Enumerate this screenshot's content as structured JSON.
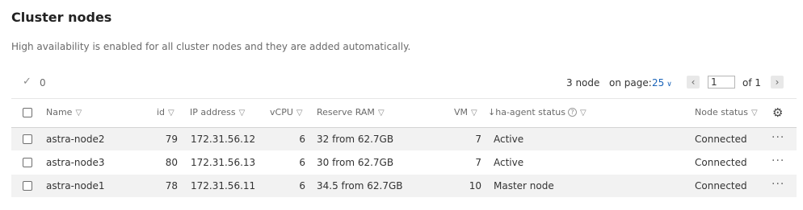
{
  "page": {
    "title": "Cluster nodes",
    "subtitle": "High availability is enabled for all cluster nodes and they are added automatically."
  },
  "toolbar": {
    "selected_count": "0",
    "node_count": "3 node",
    "on_page_label": "on page:",
    "on_page_value": "25",
    "page_value": "1",
    "of_label": "of 1"
  },
  "table": {
    "columns": {
      "name": "Name",
      "id": "id",
      "ip": "IP address",
      "vcpu": "vCPU",
      "ram": "Reserve RAM",
      "vm": "VM",
      "ha": "↓ha-agent status",
      "status": "Node status"
    },
    "rows": [
      {
        "name": "astra-node2",
        "id": "79",
        "ip": "172.31.56.12",
        "vcpu": "6",
        "ram": "32 from 62.7GB",
        "vm": "7",
        "ha": "Active",
        "status": "Connected"
      },
      {
        "name": "astra-node3",
        "id": "80",
        "ip": "172.31.56.13",
        "vcpu": "6",
        "ram": "30 from 62.7GB",
        "vm": "7",
        "ha": "Active",
        "status": "Connected"
      },
      {
        "name": "astra-node1",
        "id": "78",
        "ip": "172.31.56.11",
        "vcpu": "6",
        "ram": "34.5 from 62.7GB",
        "vm": "10",
        "ha": "Master node",
        "status": "Connected"
      }
    ]
  },
  "colors": {
    "link": "#1a63b8",
    "success": "#2e7d32",
    "row_alt": "#f2f2f2"
  },
  "icons": [
    "check-icon",
    "chevron-down-icon",
    "chevron-left-icon",
    "chevron-right-icon",
    "filter-icon",
    "info-icon",
    "gear-icon",
    "more-icon"
  ]
}
